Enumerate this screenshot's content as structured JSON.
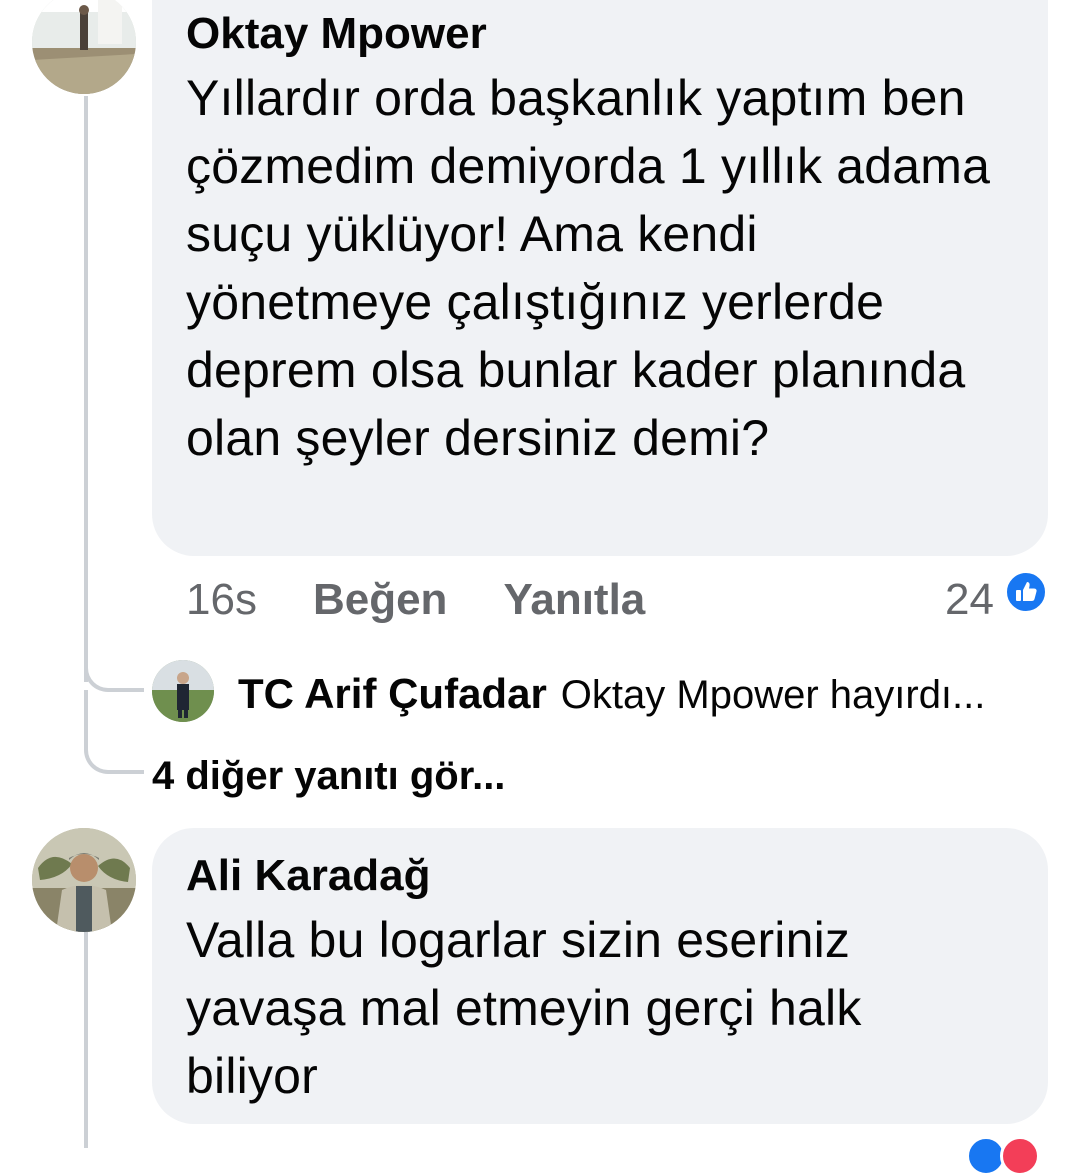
{
  "comments": [
    {
      "author": "Oktay Mpower",
      "text": "Yıllardır orda başkanlık yaptım ben çözmedim demiyorda 1 yıllık adama suçu yüklüyor! Ama kendi yönetmeye çalıştığınız yerlerde deprem olsa bunlar kader planında olan şeyler dersiniz demi?",
      "time": "16s",
      "like_label": "Beğen",
      "reply_label": "Yanıtla",
      "reaction_count": "24",
      "reaction_icon": "like-icon",
      "reply_preview": {
        "author": "TC Arif Çufadar",
        "text": "Oktay Mpower hayırdı..."
      },
      "more_replies": "4 diğer yanıtı gör..."
    },
    {
      "author": "Ali Karadağ",
      "text": "Valla bu logarlar sizin eseriniz yavaşa mal etmeyin gerçi halk biliyor"
    }
  ],
  "colors": {
    "bubble": "#f0f2f5",
    "meta_text": "#65676b",
    "like_blue": "#1877f2",
    "thread_line": "#ccd0d5"
  }
}
